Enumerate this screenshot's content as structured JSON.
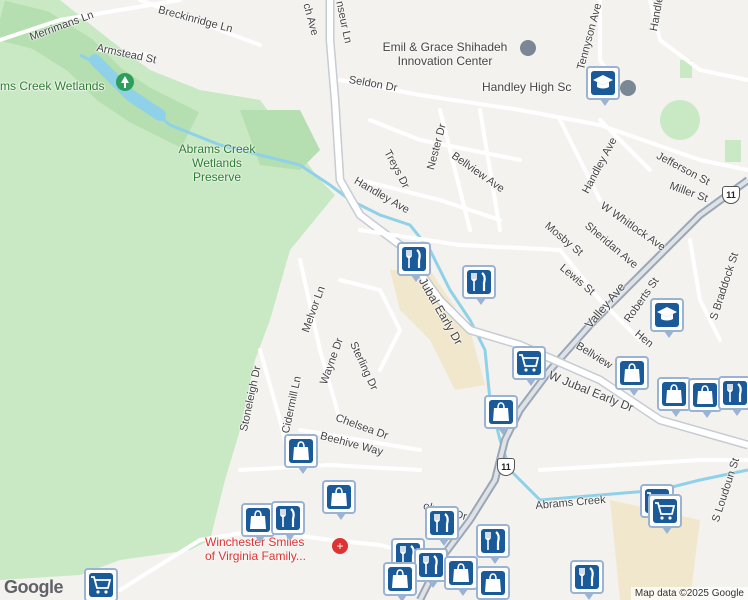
{
  "map": {
    "attribution": "Map data ©2025 Google",
    "logo": "Google",
    "route_shield": "11"
  },
  "streets": [
    {
      "key": "merrimans",
      "text": "Merrimans Ln"
    },
    {
      "key": "breckinridge",
      "text": "Breckinridge Ln"
    },
    {
      "key": "armstead",
      "text": "Armstead St"
    },
    {
      "key": "tennyson",
      "text": "Tennyson Ave"
    },
    {
      "key": "handley_top",
      "text": "Handle"
    },
    {
      "key": "seldon",
      "text": "Seldon Dr"
    },
    {
      "key": "treys",
      "text": "Treys Dr"
    },
    {
      "key": "nester",
      "text": "Nester Dr"
    },
    {
      "key": "bellview1",
      "text": "Bellview Ave"
    },
    {
      "key": "handley_ave",
      "text": "Handley Ave"
    },
    {
      "key": "handley_ave2",
      "text": "Handley Ave"
    },
    {
      "key": "jefferson",
      "text": "Jefferson St"
    },
    {
      "key": "miller",
      "text": "Miller St"
    },
    {
      "key": "whitlock",
      "text": "W Whitlock Ave"
    },
    {
      "key": "sheridan",
      "text": "Sheridan Ave"
    },
    {
      "key": "mosby",
      "text": "Mosby St"
    },
    {
      "key": "lewis",
      "text": "Lewis St"
    },
    {
      "key": "valley",
      "text": "Valley Ave"
    },
    {
      "key": "roberts",
      "text": "Roberts St"
    },
    {
      "key": "braddock",
      "text": "S Braddock St"
    },
    {
      "key": "jubal_early",
      "text": "Jubal Early Dr"
    },
    {
      "key": "w_jubal_early",
      "text": "W Jubal Early Dr"
    },
    {
      "key": "bellview2",
      "text": "Bellview"
    },
    {
      "key": "melvor",
      "text": "Melvor Ln"
    },
    {
      "key": "wayne",
      "text": "Wayne Dr"
    },
    {
      "key": "sterling",
      "text": "Sterling Dr"
    },
    {
      "key": "stoneleigh",
      "text": "Stoneleigh Dr"
    },
    {
      "key": "cidermill",
      "text": "Cidermill Ln"
    },
    {
      "key": "chelsea",
      "text": "Chelsea Dr"
    },
    {
      "key": "beehive",
      "text": "Beehive Way"
    },
    {
      "key": "abrams_creek",
      "text": "Abrams Creek"
    },
    {
      "key": "loudoun",
      "text": "S Loudoun St"
    },
    {
      "key": "ave_top",
      "text": "ch Ave"
    },
    {
      "key": "seur",
      "text": "nseur Ln"
    },
    {
      "key": "holman",
      "text": "olman Dr"
    },
    {
      "key": "hen",
      "text": "Hen"
    }
  ],
  "places": {
    "wetlands": "ms Creek Wetlands",
    "preserve": [
      "Abrams Creek",
      "Wetlands",
      "Preserve"
    ],
    "innovation": [
      "Emil & Grace Shihadeh",
      "Innovation Center"
    ],
    "handley_high": "Handley High Sc",
    "winchester": [
      "Winchester Smiles",
      "of Virginia Family..."
    ]
  },
  "pins": [
    {
      "key": "school1",
      "icon": "graduation-cap"
    },
    {
      "key": "school2",
      "icon": "graduation-cap"
    },
    {
      "key": "rest1",
      "icon": "fork-knife"
    },
    {
      "key": "rest2",
      "icon": "fork-knife"
    },
    {
      "key": "cart1",
      "icon": "shopping-cart"
    },
    {
      "key": "bag1",
      "icon": "shopping-bag"
    },
    {
      "key": "bag2",
      "icon": "shopping-bag"
    },
    {
      "key": "bag3",
      "icon": "shopping-bag"
    },
    {
      "key": "bag4",
      "icon": "shopping-bag"
    },
    {
      "key": "rest3",
      "icon": "fork-knife"
    },
    {
      "key": "bag5",
      "icon": "shopping-bag"
    },
    {
      "key": "bag6",
      "icon": "shopping-bag"
    },
    {
      "key": "bag7",
      "icon": "shopping-bag"
    },
    {
      "key": "rest4",
      "icon": "fork-knife"
    },
    {
      "key": "rest5",
      "icon": "fork-knife"
    },
    {
      "key": "rest6",
      "icon": "fork-knife"
    },
    {
      "key": "cart2",
      "icon": "shopping-cart"
    },
    {
      "key": "cart3",
      "icon": "shopping-cart"
    },
    {
      "key": "bag8",
      "icon": "shopping-bag"
    },
    {
      "key": "rest7",
      "icon": "fork-knife"
    },
    {
      "key": "bag9",
      "icon": "shopping-bag"
    },
    {
      "key": "bag10",
      "icon": "shopping-bag"
    },
    {
      "key": "rest8",
      "icon": "fork-knife"
    },
    {
      "key": "cart4",
      "icon": "shopping-cart"
    },
    {
      "key": "rest9",
      "icon": "fork-knife"
    }
  ],
  "colors": {
    "park": "#c9e8c4",
    "water": "#8fd1e8",
    "road": "#ffffff",
    "highway": "#9aa7b5",
    "commercial": "#f1e7cc",
    "pin_fill": "#1a5a99"
  }
}
